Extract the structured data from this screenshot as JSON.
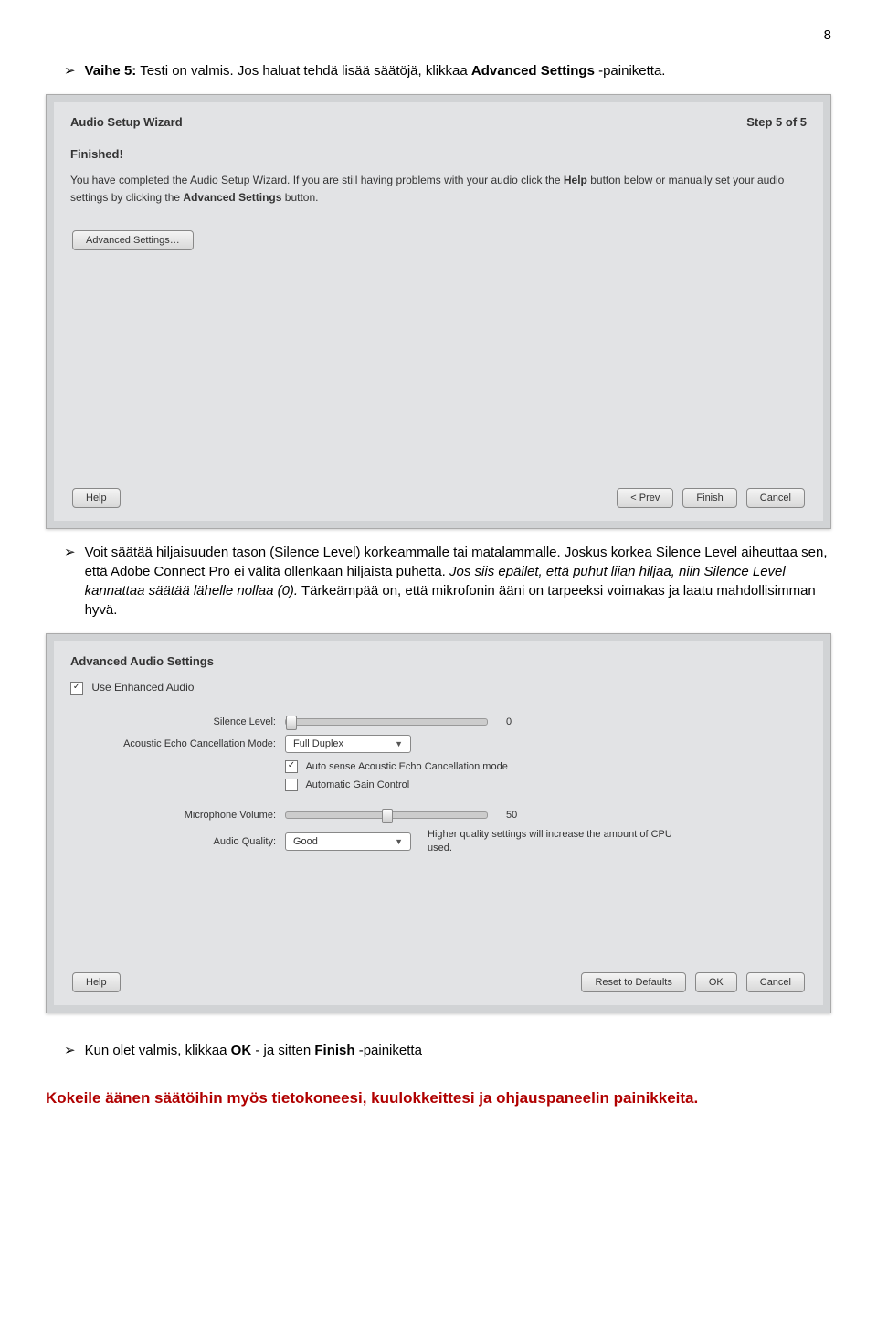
{
  "page_number": "8",
  "para1": {
    "prefix": "Vaihe 5:",
    "mid": " Testi on valmis. Jos haluat tehdä lisää säätöjä, klikkaa ",
    "bold": "Advanced Settings",
    "suffix": " -painiketta."
  },
  "dialog1": {
    "title": "Audio Setup Wizard",
    "step": "Step 5 of 5",
    "subtitle": "Finished!",
    "text_a": "You have completed the Audio Setup Wizard. If you are still having problems with your audio click the ",
    "text_b": "Help",
    "text_c": " button below or manually set your audio settings by clicking the ",
    "text_d": "Advanced Settings",
    "text_e": " button.",
    "adv_btn": "Advanced Settings…",
    "help": "Help",
    "prev": "< Prev",
    "finish": "Finish",
    "cancel": "Cancel"
  },
  "para2": "Voit säätää hiljaisuuden tason (Silence Level) korkeammalle tai matalammalle. Joskus korkea Silence Level aiheuttaa sen, että Adobe Connect Pro ei välitä ollenkaan hiljaista puhetta. ",
  "para2_italic": "Jos siis epäilet, että puhut liian hiljaa, niin Silence Level kannattaa säätää lähelle nollaa (0).",
  "para2_tail": " Tärkeämpää on, että mikrofonin ääni on tarpeeksi voimakas ja laatu mahdollisimman hyvä.",
  "dialog2": {
    "title": "Advanced Audio Settings",
    "enhanced": "Use Enhanced Audio",
    "silence_label": "Silence Level:",
    "silence_val": "0",
    "echo_label": "Acoustic Echo Cancellation Mode:",
    "echo_val": "Full Duplex",
    "auto_sense": "Auto sense Acoustic Echo Cancellation mode",
    "agc": "Automatic Gain Control",
    "mic_label": "Microphone Volume:",
    "mic_val": "50",
    "quality_label": "Audio Quality:",
    "quality_val": "Good",
    "quality_hint": "Higher quality settings will increase the amount of CPU used.",
    "help": "Help",
    "reset": "Reset to Defaults",
    "ok": "OK",
    "cancel": "Cancel"
  },
  "para3": {
    "a": "Kun olet valmis, klikkaa ",
    "b": "OK",
    "c": "- ja sitten ",
    "d": "Finish",
    "e": "-painiketta"
  },
  "red_line": "Kokeile äänen säätöihin myös tietokoneesi, kuulokkeittesi ja ohjauspaneelin painikkeita."
}
